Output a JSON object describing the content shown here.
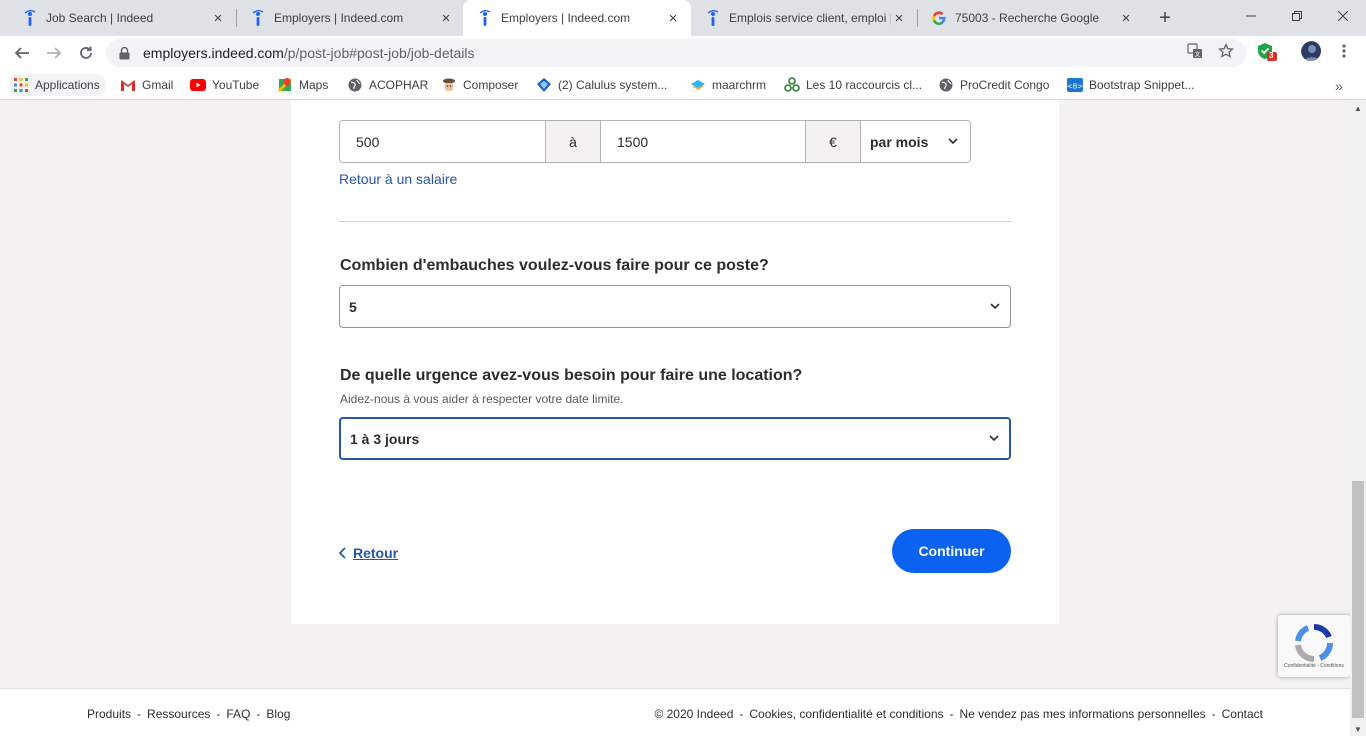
{
  "browser": {
    "tabs": [
      {
        "label": "Job Search | Indeed",
        "icon": "indeed-icon"
      },
      {
        "label": "Employers | Indeed.com",
        "icon": "indeed-icon"
      },
      {
        "label": "Employers | Indeed.com",
        "icon": "indeed-icon",
        "active": true
      },
      {
        "label": "Emplois service client, emploi |",
        "icon": "indeed-icon"
      },
      {
        "label": "75003 - Recherche Google",
        "icon": "google-icon"
      }
    ],
    "url_host": "employers.indeed.com",
    "url_path": "/p/post-job#post-job/job-details",
    "extension_badge": "3",
    "bookmarks": [
      {
        "label": "Applications",
        "icon": "apps-grid-icon"
      },
      {
        "label": "Gmail",
        "icon": "gmail-icon"
      },
      {
        "label": "YouTube",
        "icon": "youtube-icon"
      },
      {
        "label": "Maps",
        "icon": "maps-icon"
      },
      {
        "label": "ACOPHAR",
        "icon": "globe-icon"
      },
      {
        "label": "Composer",
        "icon": "composer-icon"
      },
      {
        "label": "(2) Calulus system...",
        "icon": "calulus-icon"
      },
      {
        "label": "maarchrm",
        "icon": "maarch-icon"
      },
      {
        "label": "Les 10 raccourcis cl...",
        "icon": "raccourcis-icon"
      },
      {
        "label": "ProCredit Congo",
        "icon": "globe-icon"
      },
      {
        "label": "Bootstrap Snippet...",
        "icon": "bootstrap-icon"
      }
    ],
    "more_bookmarks": "»"
  },
  "salary": {
    "min": "500",
    "separator": "à",
    "max": "1500",
    "currency": "€",
    "period": "par mois",
    "back_link": "Retour à un salaire"
  },
  "hires": {
    "question": "Combien d'embauches voulez-vous faire pour ce poste?",
    "value": "5"
  },
  "urgency": {
    "question": "De quelle urgence avez-vous besoin pour faire une location?",
    "help": "Aidez-nous à vous aider à respecter votre date limite.",
    "value": "1 à 3 jours"
  },
  "actions": {
    "back": "Retour",
    "continue": "Continuer"
  },
  "footer": {
    "left": [
      "Produits",
      "Ressources",
      "FAQ",
      "Blog"
    ],
    "separator": "-",
    "right": [
      "© 2020 Indeed",
      "Cookies, confidentialité et conditions",
      "Ne vendez pas mes informations personnelles",
      "Contact"
    ]
  },
  "recaptcha": {
    "text": "Confidentialité - Conditions"
  },
  "colors": {
    "accent": "#0b61f0",
    "link": "#2557a7",
    "page_bg": "#f3f2f1"
  }
}
